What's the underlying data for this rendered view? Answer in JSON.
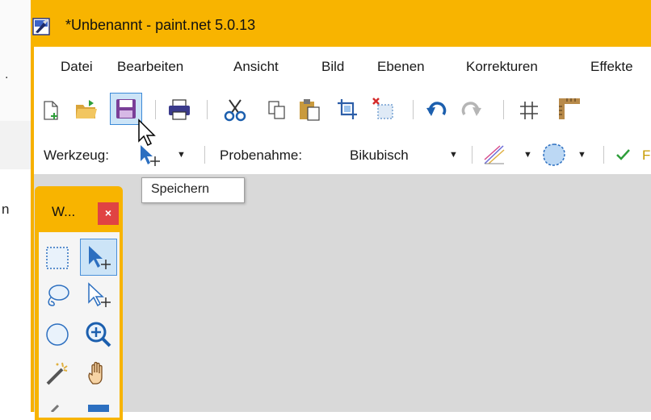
{
  "window": {
    "title": "*Unbenannt - paint.net 5.0.13",
    "accent_color": "#f8b400"
  },
  "menu": [
    "Datei",
    "Bearbeiten",
    "Ansicht",
    "Bild",
    "Ebenen",
    "Korrekturen",
    "Effekte"
  ],
  "toolbar": {
    "icons": [
      "new-file-icon",
      "open-folder-icon",
      "save-icon",
      "print-icon",
      "cut-icon",
      "copy-icon",
      "paste-icon",
      "crop-icon",
      "deselect-icon",
      "undo-icon",
      "redo-icon",
      "grid-icon",
      "ruler-icon"
    ]
  },
  "options_bar": {
    "tool_label": "Werkzeug:",
    "sampling_label": "Probenahme:",
    "sampling_value": "Bikubisch",
    "partial_label": "F"
  },
  "tooltip": {
    "text": "Speichern"
  },
  "tools_panel": {
    "title": "W...",
    "close_label": "×",
    "tools": [
      "rectangle-select",
      "move-selection",
      "lasso-select",
      "move-selection-outline",
      "ellipse-select",
      "zoom",
      "magic-wand",
      "pan"
    ]
  },
  "background_window": {
    "text_dot": ".",
    "text_n": "n"
  }
}
